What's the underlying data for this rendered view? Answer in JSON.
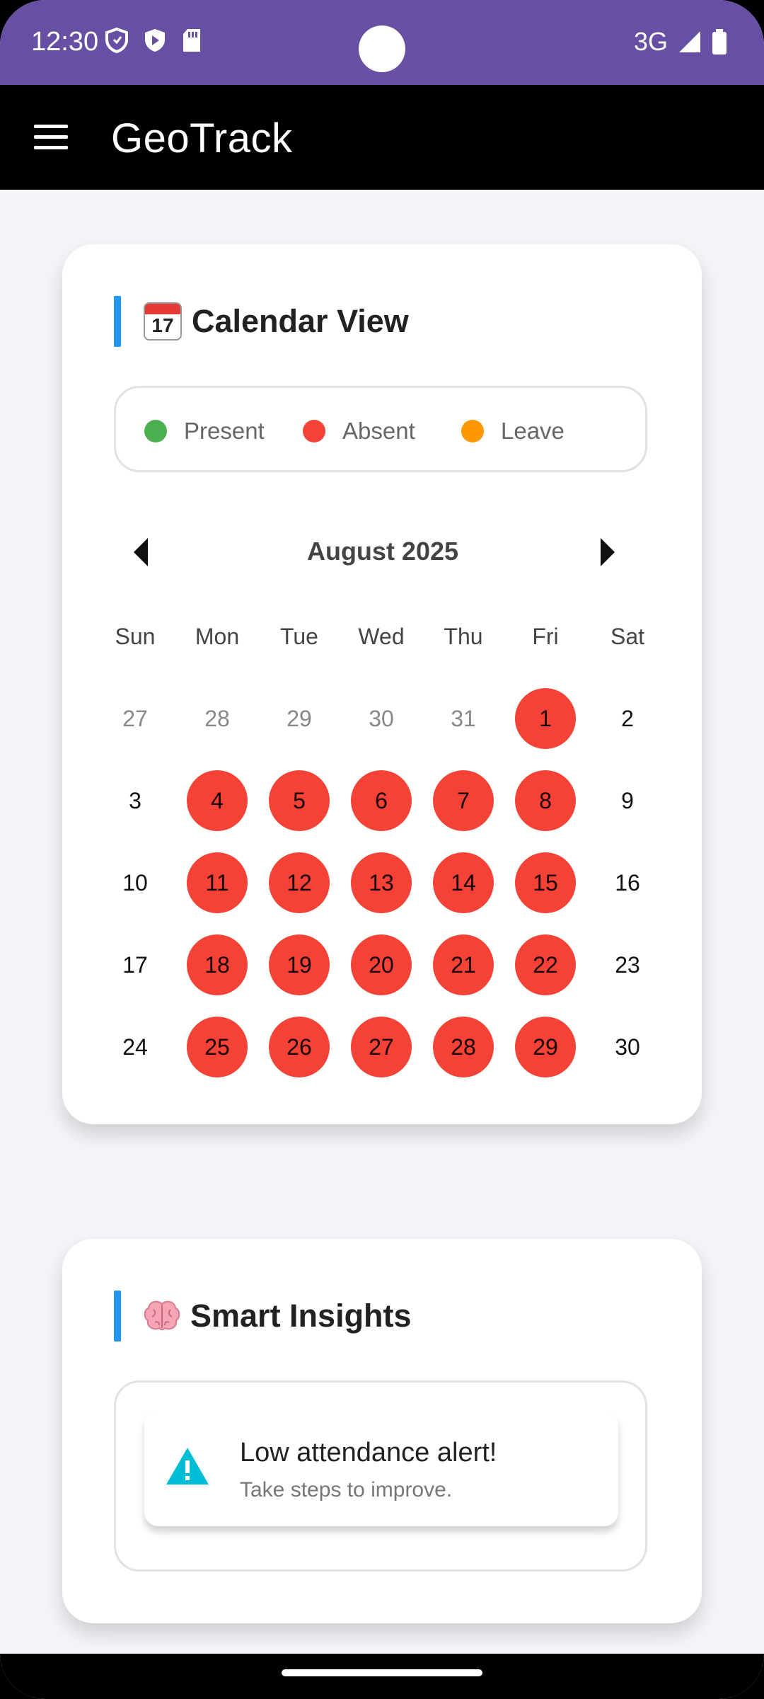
{
  "status_bar": {
    "time": "12:30",
    "network": "3G"
  },
  "app_bar": {
    "title": "GeoTrack"
  },
  "calendar_card": {
    "title": "Calendar View",
    "legend": [
      {
        "label": "Present",
        "color": "#4caf50"
      },
      {
        "label": "Absent",
        "color": "#f44336"
      },
      {
        "label": "Leave",
        "color": "#ff9800"
      }
    ],
    "month": "August 2025",
    "weekdays": [
      "Sun",
      "Mon",
      "Tue",
      "Wed",
      "Thu",
      "Fri",
      "Sat"
    ],
    "weeks": [
      [
        {
          "d": "27",
          "s": "muted"
        },
        {
          "d": "28",
          "s": "muted"
        },
        {
          "d": "29",
          "s": "muted"
        },
        {
          "d": "30",
          "s": "muted"
        },
        {
          "d": "31",
          "s": "muted"
        },
        {
          "d": "1",
          "s": "absent"
        },
        {
          "d": "2",
          "s": ""
        }
      ],
      [
        {
          "d": "3",
          "s": ""
        },
        {
          "d": "4",
          "s": "absent"
        },
        {
          "d": "5",
          "s": "absent"
        },
        {
          "d": "6",
          "s": "absent"
        },
        {
          "d": "7",
          "s": "absent"
        },
        {
          "d": "8",
          "s": "absent"
        },
        {
          "d": "9",
          "s": ""
        }
      ],
      [
        {
          "d": "10",
          "s": ""
        },
        {
          "d": "11",
          "s": "absent"
        },
        {
          "d": "12",
          "s": "absent"
        },
        {
          "d": "13",
          "s": "absent"
        },
        {
          "d": "14",
          "s": "absent"
        },
        {
          "d": "15",
          "s": "absent"
        },
        {
          "d": "16",
          "s": ""
        }
      ],
      [
        {
          "d": "17",
          "s": ""
        },
        {
          "d": "18",
          "s": "absent"
        },
        {
          "d": "19",
          "s": "absent"
        },
        {
          "d": "20",
          "s": "absent"
        },
        {
          "d": "21",
          "s": "absent"
        },
        {
          "d": "22",
          "s": "absent"
        },
        {
          "d": "23",
          "s": ""
        }
      ],
      [
        {
          "d": "24",
          "s": ""
        },
        {
          "d": "25",
          "s": "absent"
        },
        {
          "d": "26",
          "s": "absent"
        },
        {
          "d": "27",
          "s": "absent"
        },
        {
          "d": "28",
          "s": "absent"
        },
        {
          "d": "29",
          "s": "absent"
        },
        {
          "d": "30",
          "s": ""
        }
      ]
    ]
  },
  "insights_card": {
    "title": "Smart Insights",
    "alert_title": "Low attendance alert!",
    "alert_subtitle": "Take steps to improve."
  },
  "colors": {
    "accent": "#2196f3",
    "status_bar": "#6750a4",
    "absent": "#f44336",
    "alert_icon": "#00bcd4"
  }
}
